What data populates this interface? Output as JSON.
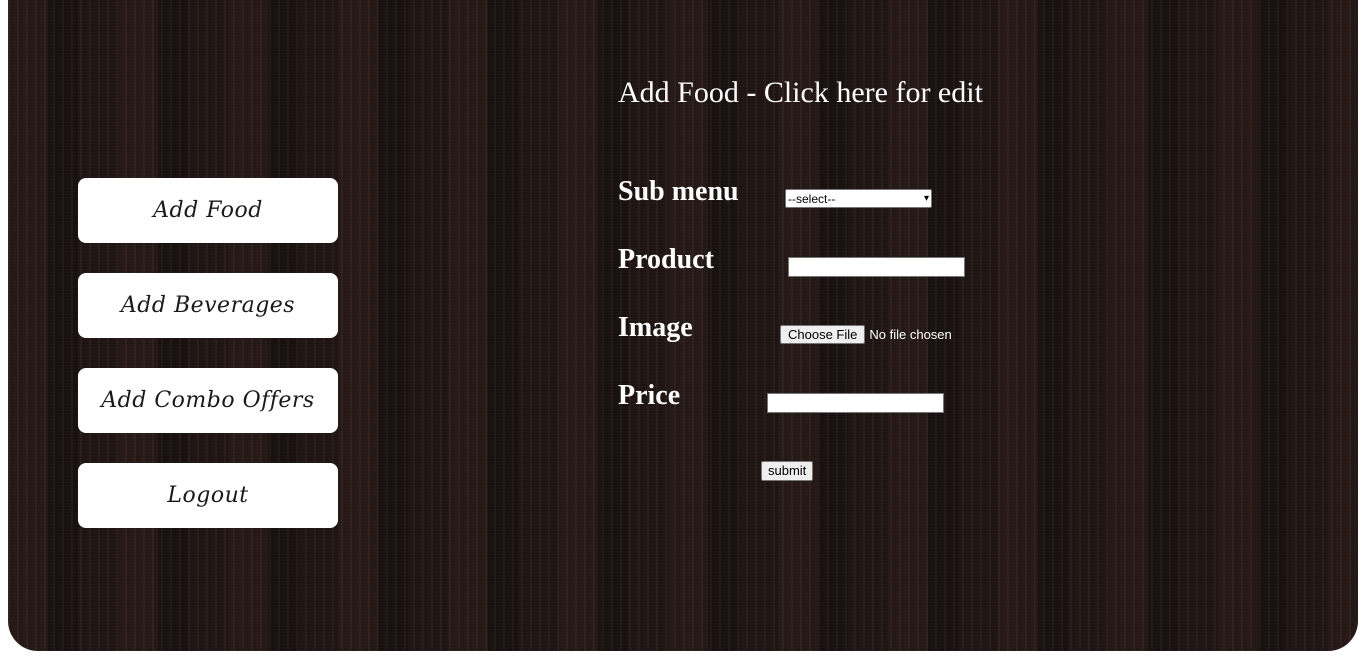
{
  "sidebar": {
    "items": [
      {
        "label": "Add Food"
      },
      {
        "label": "Add Beverages"
      },
      {
        "label": "Add Combo Offers"
      },
      {
        "label": "Logout"
      }
    ]
  },
  "main": {
    "title": "Add Food - Click here for edit",
    "form": {
      "submenu_label": "Sub menu",
      "submenu_selected": "--select--",
      "product_label": "Product",
      "product_value": "",
      "image_label": "Image",
      "file_button": "Choose File",
      "file_status": "No file chosen",
      "price_label": "Price",
      "price_value": "",
      "submit_label": "submit"
    }
  },
  "colors": {
    "background": "#1c1311",
    "nav_button": "#ffffff",
    "text": "#ffffff"
  }
}
